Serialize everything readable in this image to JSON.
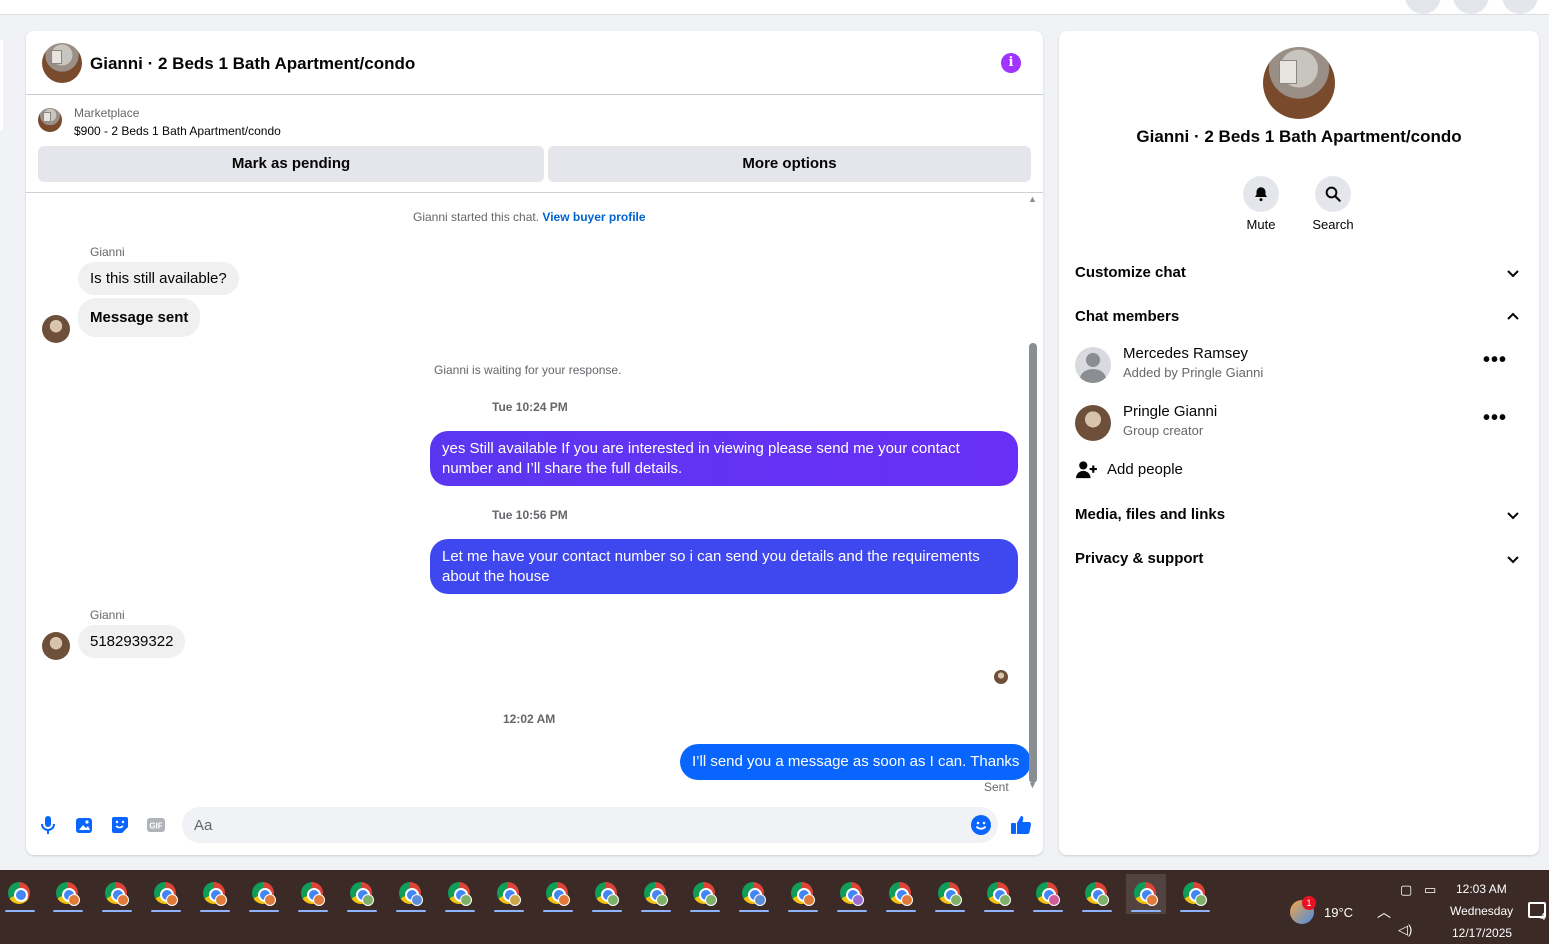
{
  "chat": {
    "title": "Gianni · 2 Beds 1 Bath Apartment/condo",
    "listing_label": "Marketplace",
    "listing_price": "$900 - 2 Beds 1 Bath Apartment/condo",
    "mark_pending": "Mark as pending",
    "more_options": "More options",
    "started_text": "Gianni started this chat.",
    "view_profile": "View buyer profile",
    "messages": {
      "sender1": "Gianni",
      "m1": "Is this still available?",
      "m2": "Message sent",
      "waiting": "Gianni is waiting for your response.",
      "ts1": "Tue 10:24 PM",
      "m3": "yes Still available If you are interested in viewing please send me your contact number and I’ll share the full details.",
      "ts2": "Tue 10:56 PM",
      "m4": "Let me have your contact number so i can send you details and the requirements about the house",
      "sender2": "Gianni",
      "m5": "5182939322",
      "ts3": "12:02 AM",
      "m6": "I’ll send you a message as soon as I can. Thanks",
      "sent": "Sent"
    },
    "composer_placeholder": "Aa"
  },
  "side": {
    "title": "Gianni · 2 Beds 1 Bath Apartment/condo",
    "mute": "Mute",
    "search": "Search",
    "customize": "Customize chat",
    "members_header": "Chat members",
    "members": [
      {
        "name": "Mercedes Ramsey",
        "sub": "Added by Pringle Gianni"
      },
      {
        "name": "Pringle Gianni",
        "sub": "Group creator"
      }
    ],
    "add_people": "Add people",
    "media": "Media, files and links",
    "privacy": "Privacy & support"
  },
  "taskbar": {
    "weather": "19°C",
    "weather_badge": "1",
    "time": "12:03 AM",
    "day": "Wednesday",
    "date": "12/17/2025",
    "notif_count": "4"
  },
  "colors": {
    "accent": "#0866ff",
    "bubble_grad_top": "#7b2ff7",
    "bubble_mid": "#4a3ff2",
    "bubble_blue": "#3b4ef0",
    "info": "#a033ff"
  }
}
